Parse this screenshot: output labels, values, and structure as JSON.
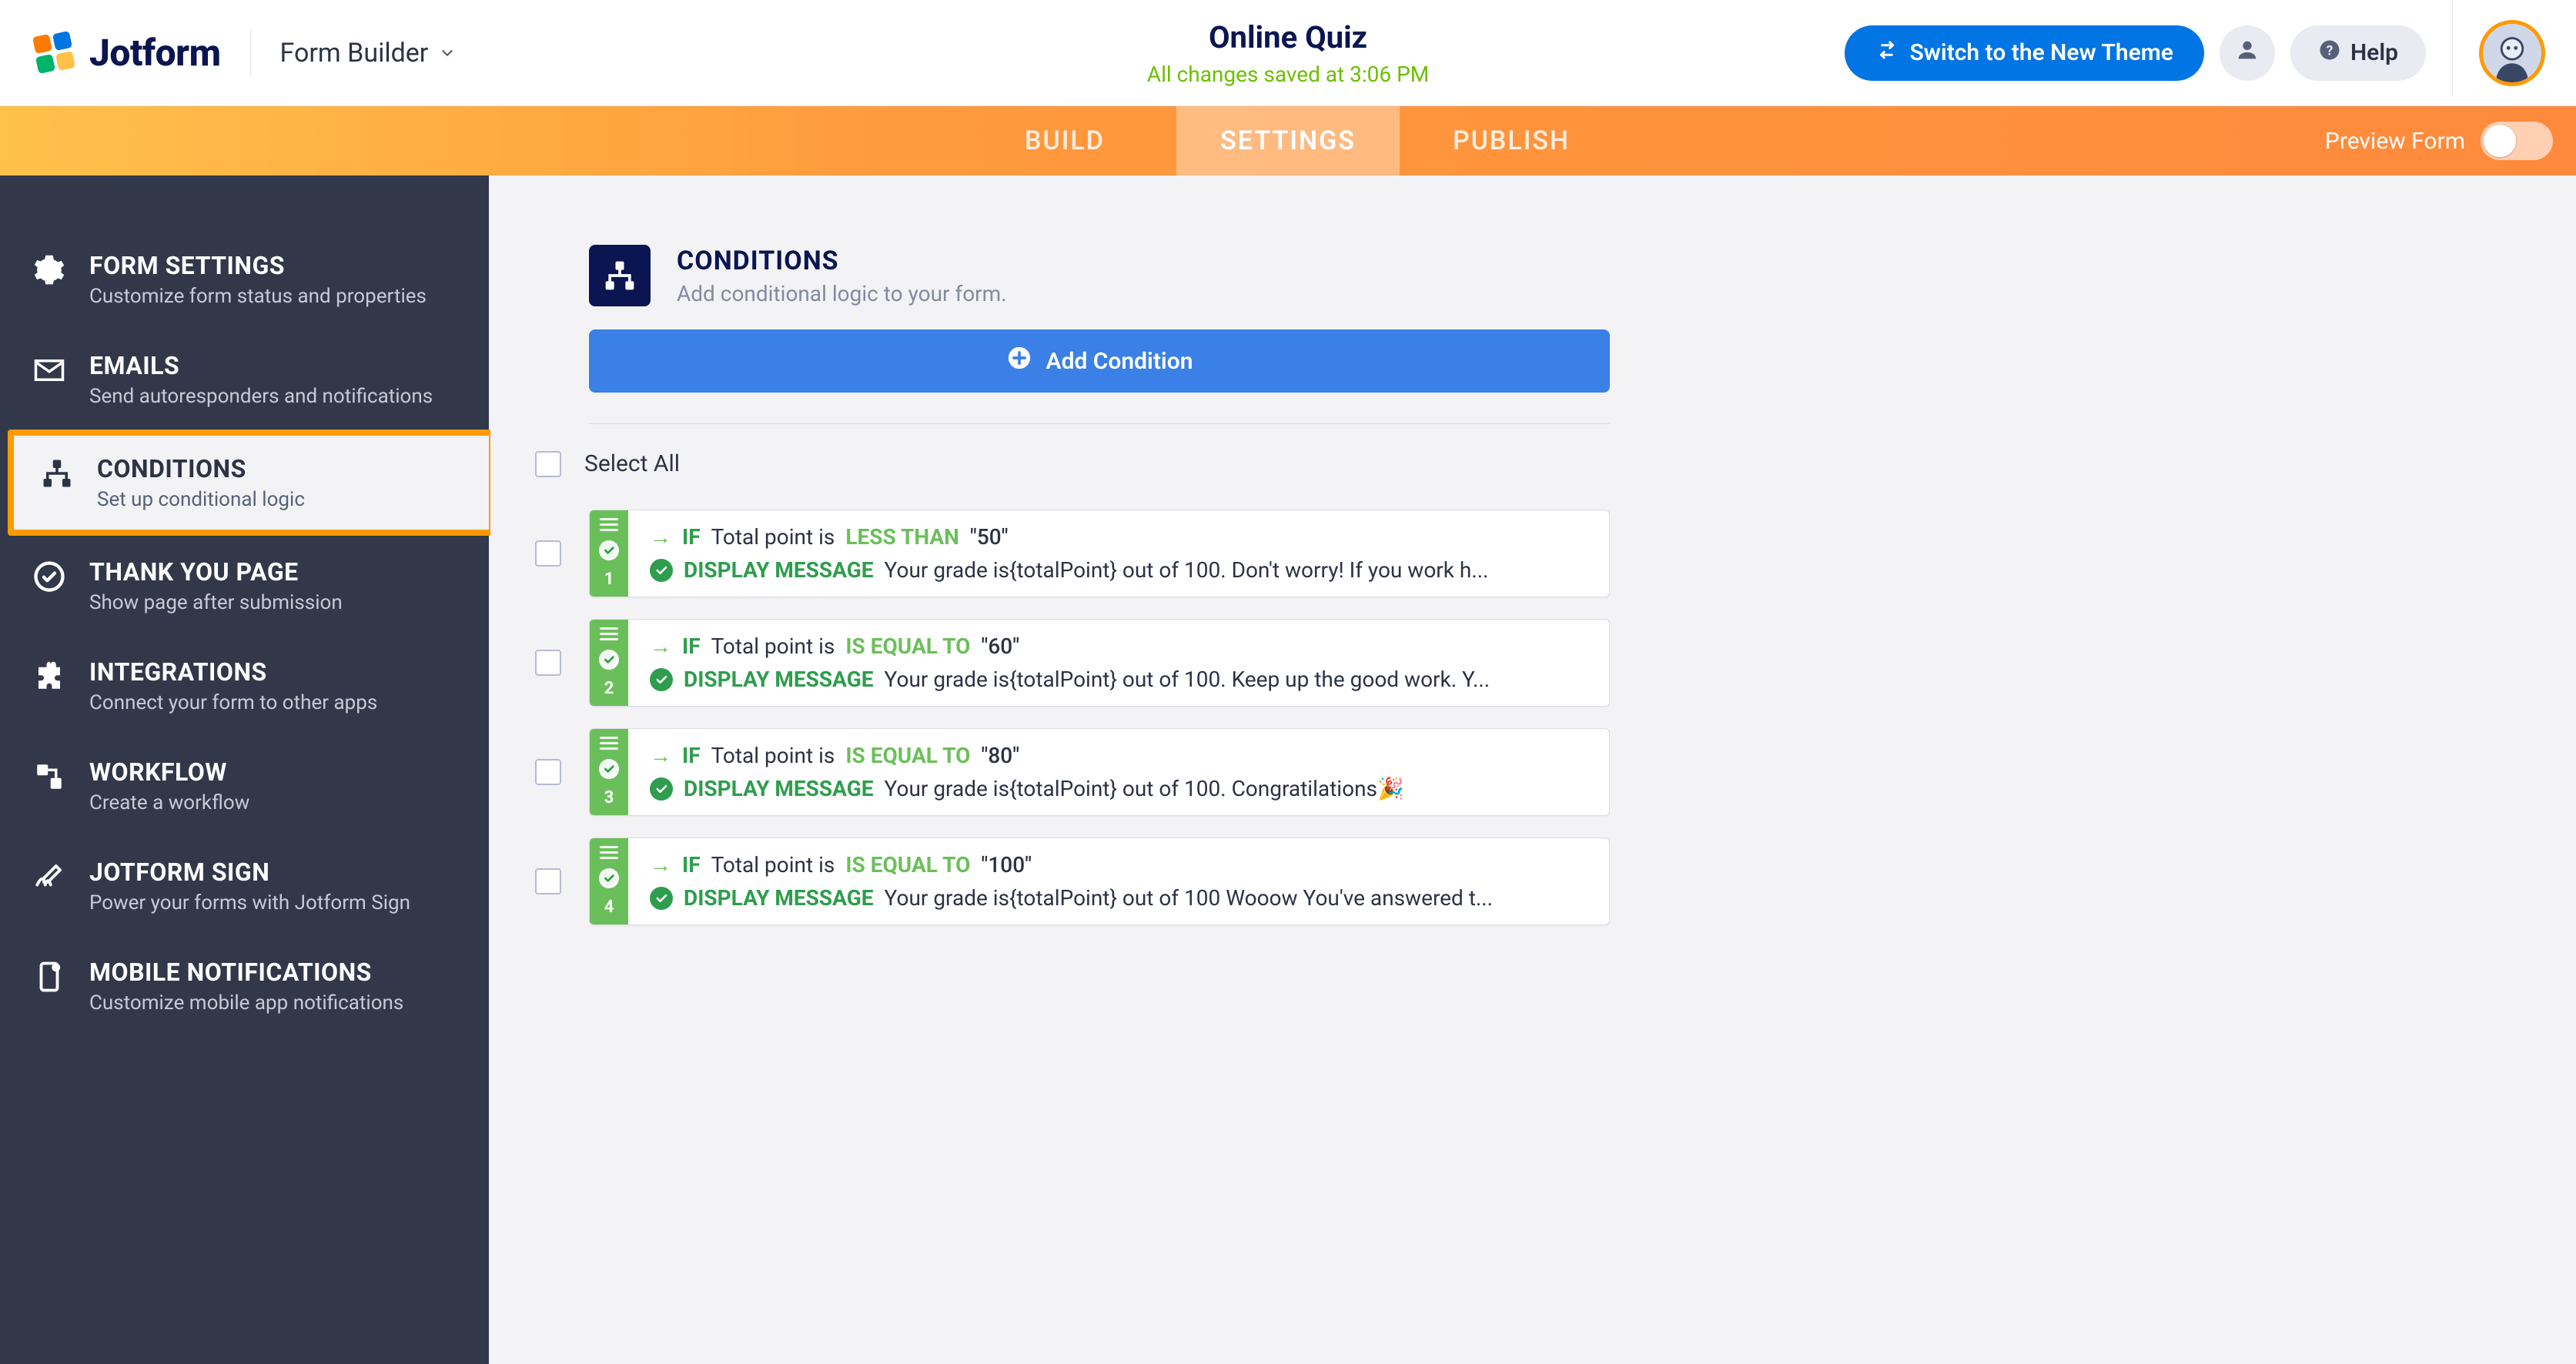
{
  "header": {
    "brand": "Jotform",
    "builder_label": "Form Builder",
    "form_title": "Online Quiz",
    "save_status": "All changes saved at 3:06 PM",
    "new_theme": "Switch to the New Theme",
    "help": "Help"
  },
  "ribbon": {
    "tabs": [
      "BUILD",
      "SETTINGS",
      "PUBLISH"
    ],
    "active_index": 1,
    "preview": "Preview Form"
  },
  "sidebar": {
    "items": [
      {
        "title": "FORM SETTINGS",
        "sub": "Customize form status and properties"
      },
      {
        "title": "EMAILS",
        "sub": "Send autoresponders and notifications"
      },
      {
        "title": "CONDITIONS",
        "sub": "Set up conditional logic"
      },
      {
        "title": "THANK YOU PAGE",
        "sub": "Show page after submission"
      },
      {
        "title": "INTEGRATIONS",
        "sub": "Connect your form to other apps"
      },
      {
        "title": "WORKFLOW",
        "sub": "Create a workflow"
      },
      {
        "title": "JOTFORM SIGN",
        "sub": "Power your forms with Jotform Sign"
      },
      {
        "title": "MOBILE NOTIFICATIONS",
        "sub": "Customize mobile app notifications"
      }
    ],
    "active_index": 2
  },
  "panel": {
    "title": "CONDITIONS",
    "subtitle": "Add conditional logic to your form.",
    "add_button": "Add Condition",
    "select_all": "Select All",
    "if_label": "IF",
    "field_label": "Total point is",
    "display_message_label": "DISPLAY MESSAGE",
    "conditions": [
      {
        "num": "1",
        "operator": "LESS THAN",
        "value": "\"50\"",
        "message": "Your grade is{totalPoint} out of 100. Don't worry! If you work h..."
      },
      {
        "num": "2",
        "operator": "IS EQUAL TO",
        "value": "\"60\"",
        "message": "Your grade is{totalPoint} out of 100. Keep up the good work. Y..."
      },
      {
        "num": "3",
        "operator": "IS EQUAL TO",
        "value": "\"80\"",
        "message": "Your grade is{totalPoint} out of 100. Congratilations🎉"
      },
      {
        "num": "4",
        "operator": "IS EQUAL TO",
        "value": "\"100\"",
        "message": "Your grade is{totalPoint} out of 100 Wooow You've answered t..."
      }
    ]
  }
}
